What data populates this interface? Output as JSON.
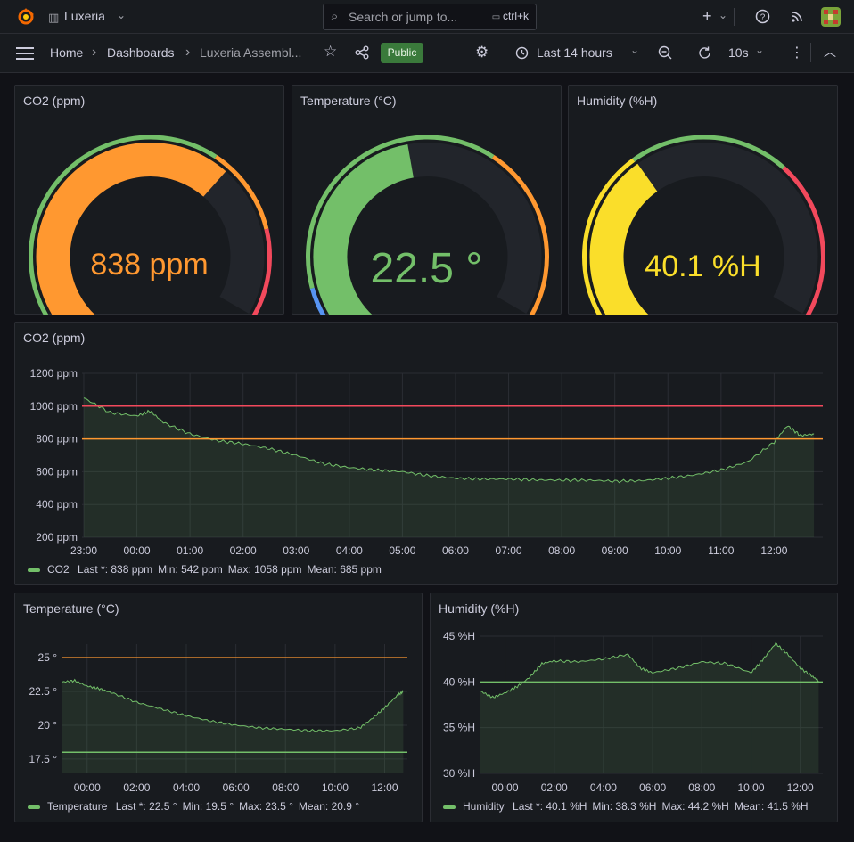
{
  "topbar": {
    "org": "Luxeria",
    "search_placeholder": "Search or jump to...",
    "shortcut": "ctrl+k"
  },
  "navbar": {
    "breadcrumb": [
      "Home",
      "Dashboards",
      "Luxeria Assembl..."
    ],
    "badge": "Public",
    "time_range": "Last 14 hours",
    "refresh": "10s"
  },
  "colors": {
    "green": "#73bf69",
    "orange": "#ff9830",
    "red": "#f2495c",
    "yellow": "#fade2a",
    "blue": "#5794f2"
  },
  "gauges": [
    {
      "title": "CO2 (ppm)",
      "value_text": "838 ppm",
      "value": 838,
      "min": 0,
      "max": 1200,
      "color": "#ff9830",
      "thresholds": [
        {
          "from": 0,
          "to": 800,
          "color": "#73bf69"
        },
        {
          "from": 800,
          "to": 1000,
          "color": "#ff9830"
        },
        {
          "from": 1000,
          "to": 1200,
          "color": "#f2495c"
        }
      ]
    },
    {
      "title": "Temperature (°C)",
      "value_text": "22.5 °",
      "value": 22.5,
      "min": 15,
      "max": 30,
      "color": "#73bf69",
      "thresholds": [
        {
          "from": 15,
          "to": 17,
          "color": "#5794f2"
        },
        {
          "from": 17,
          "to": 25,
          "color": "#73bf69"
        },
        {
          "from": 25,
          "to": 30,
          "color": "#ff9830"
        }
      ]
    },
    {
      "title": "Humidity (%H)",
      "value_text": "40.1 %H",
      "value": 40.1,
      "min": 20,
      "max": 70,
      "color": "#fade2a",
      "thresholds": [
        {
          "from": 20,
          "to": 40,
          "color": "#fade2a"
        },
        {
          "from": 40,
          "to": 55,
          "color": "#73bf69"
        },
        {
          "from": 55,
          "to": 70,
          "color": "#f2495c"
        }
      ]
    }
  ],
  "legends": {
    "co2": {
      "name": "CO2",
      "last": "Last *: 838 ppm",
      "min": "Min: 542 ppm",
      "max": "Max: 1058 ppm",
      "mean": "Mean: 685 ppm"
    },
    "temp": {
      "name": "Temperature",
      "last": "Last *: 22.5 °",
      "min": "Min: 19.5 °",
      "max": "Max: 23.5 °",
      "mean": "Mean: 20.9 °"
    },
    "hum": {
      "name": "Humidity",
      "last": "Last *: 40.1 %H",
      "min": "Min: 38.3 %H",
      "max": "Max: 44.2 %H",
      "mean": "Mean: 41.5 %H"
    }
  },
  "chart_data": [
    {
      "type": "line",
      "title": "CO2 (ppm)",
      "x": [
        "23:00",
        "23:30",
        "00:00",
        "00:15",
        "00:30",
        "01:00",
        "01:30",
        "02:00",
        "02:30",
        "03:00",
        "03:30",
        "04:00",
        "04:30",
        "05:00",
        "05:30",
        "06:00",
        "06:30",
        "07:00",
        "07:30",
        "08:00",
        "08:30",
        "09:00",
        "09:30",
        "10:00",
        "10:30",
        "11:00",
        "11:30",
        "12:00",
        "12:15",
        "12:30",
        "12:45"
      ],
      "series": [
        {
          "name": "CO2",
          "values": [
            1050,
            960,
            940,
            970,
            900,
            830,
            790,
            770,
            740,
            700,
            650,
            625,
            610,
            600,
            575,
            560,
            555,
            555,
            550,
            548,
            548,
            542,
            545,
            560,
            580,
            610,
            660,
            780,
            880,
            820,
            830
          ]
        }
      ],
      "ylim": [
        200,
        1200
      ],
      "yticks": [
        "200 ppm",
        "400 ppm",
        "600 ppm",
        "800 ppm",
        "1000 ppm",
        "1200 ppm"
      ],
      "xticks": [
        "23:00",
        "00:00",
        "01:00",
        "02:00",
        "03:00",
        "04:00",
        "05:00",
        "06:00",
        "07:00",
        "08:00",
        "09:00",
        "10:00",
        "11:00",
        "12:00"
      ],
      "thresholds": [
        {
          "value": 1000,
          "color": "#f2495c"
        },
        {
          "value": 800,
          "color": "#ff9830"
        }
      ]
    },
    {
      "type": "line",
      "title": "Temperature (°C)",
      "x": [
        "23:00",
        "23:30",
        "00:00",
        "00:30",
        "01:00",
        "02:00",
        "03:00",
        "04:00",
        "05:00",
        "06:00",
        "07:00",
        "08:00",
        "09:00",
        "10:00",
        "11:00",
        "11:30",
        "12:00",
        "12:30",
        "12:45"
      ],
      "series": [
        {
          "name": "Temperature",
          "values": [
            23.2,
            23.3,
            22.9,
            22.7,
            22.4,
            21.7,
            21.2,
            20.7,
            20.3,
            20.0,
            19.8,
            19.7,
            19.6,
            19.6,
            19.8,
            20.5,
            21.3,
            22.2,
            22.5
          ]
        }
      ],
      "ylim": [
        16.5,
        26
      ],
      "yticks": [
        "17.5 °",
        "20 °",
        "22.5 °",
        "25 °"
      ],
      "xticks": [
        "00:00",
        "02:00",
        "04:00",
        "06:00",
        "08:00",
        "10:00",
        "12:00"
      ],
      "thresholds": [
        {
          "value": 25,
          "color": "#ff9830"
        },
        {
          "value": 18,
          "color": "#73bf69"
        }
      ]
    },
    {
      "type": "line",
      "title": "Humidity (%H)",
      "x": [
        "23:00",
        "23:30",
        "00:00",
        "00:30",
        "01:00",
        "01:30",
        "02:00",
        "03:00",
        "04:00",
        "05:00",
        "05:30",
        "06:00",
        "07:00",
        "08:00",
        "09:00",
        "10:00",
        "10:30",
        "11:00",
        "11:30",
        "12:00",
        "12:30",
        "12:45"
      ],
      "series": [
        {
          "name": "Humidity",
          "values": [
            39.0,
            38.3,
            38.8,
            39.5,
            40.5,
            42.0,
            42.3,
            42.2,
            42.5,
            43.0,
            41.5,
            41.0,
            41.5,
            42.2,
            42.0,
            41.0,
            42.5,
            44.2,
            43.0,
            41.5,
            40.6,
            40.1
          ]
        }
      ],
      "ylim": [
        30,
        45
      ],
      "yticks": [
        "30 %H",
        "35 %H",
        "40 %H",
        "45 %H"
      ],
      "xticks": [
        "00:00",
        "02:00",
        "04:00",
        "06:00",
        "08:00",
        "10:00",
        "12:00"
      ],
      "thresholds": [
        {
          "value": 40,
          "color": "#73bf69"
        }
      ]
    }
  ]
}
